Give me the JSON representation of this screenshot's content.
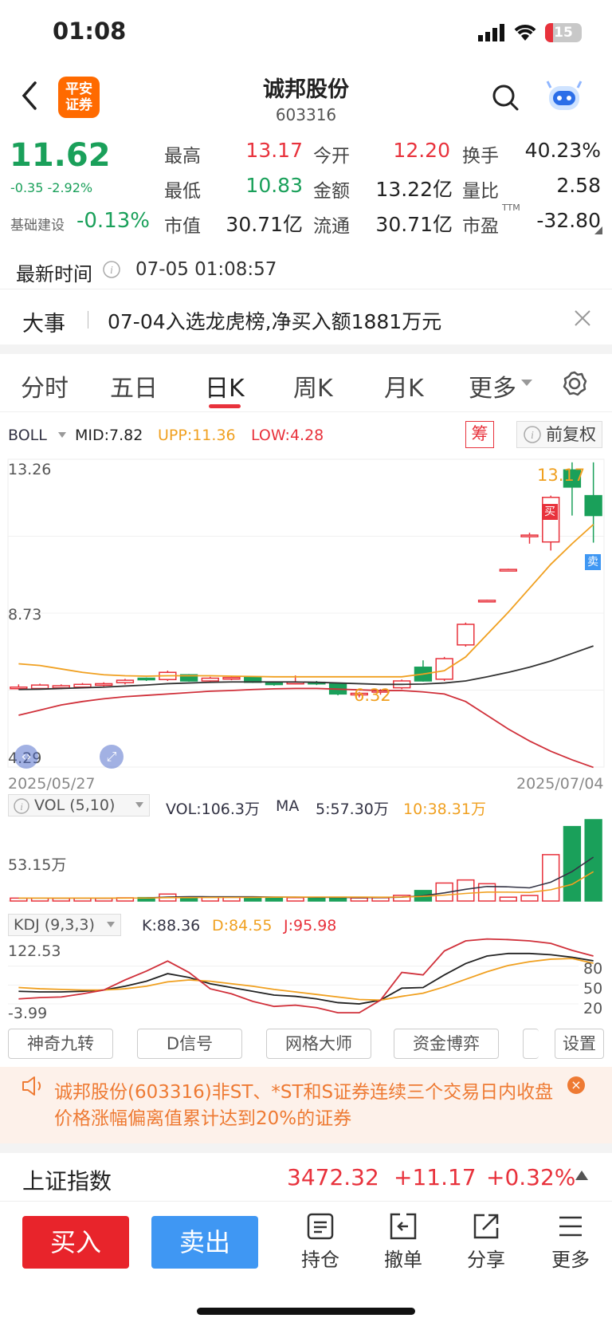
{
  "status_bar": {
    "time": "01:08",
    "battery": "15"
  },
  "header": {
    "logo_text": "平安\n证券",
    "stock_name": "诚邦股份",
    "stock_code": "603316"
  },
  "quote": {
    "price": "11.62",
    "change": "-0.35 -2.92%",
    "sector_name": "基础建设",
    "sector_change": "-0.13%",
    "fields": [
      {
        "label": "最高",
        "value": "13.17",
        "color": "red"
      },
      {
        "label": "今开",
        "value": "12.20",
        "color": "red"
      },
      {
        "label": "换手",
        "value": "40.23%",
        "color": "dark"
      },
      {
        "label": "最低",
        "value": "10.83",
        "color": "green"
      },
      {
        "label": "金额",
        "value": "13.22亿",
        "color": "dark"
      },
      {
        "label": "量比",
        "value": "2.58",
        "color": "dark"
      },
      {
        "label": "市值",
        "value": "30.71亿",
        "color": "dark"
      },
      {
        "label": "流通",
        "value": "30.71亿",
        "color": "dark"
      },
      {
        "label": "市盈",
        "value": "-32.80",
        "color": "dark"
      }
    ],
    "pe_suffix": "TTM",
    "latest_time_label": "最新时间",
    "latest_time_value": "07-05 01:08:57"
  },
  "news": {
    "title": "大事",
    "text": "07-04入选龙虎榜,净买入额1881万元"
  },
  "tabs": [
    {
      "label": "分时"
    },
    {
      "label": "五日"
    },
    {
      "label": "日K"
    },
    {
      "label": "周K"
    },
    {
      "label": "月K"
    },
    {
      "label": "更多"
    }
  ],
  "boll": {
    "name": "BOLL",
    "mid": "MID:7.82",
    "upp": "UPP:11.36",
    "low": "LOW:4.28",
    "chip_label": "筹",
    "adjust_label": "前复权",
    "y_top": "13.26",
    "y_mid": "8.73",
    "y_bottom": "4.29",
    "high_marker": "13.17",
    "low_marker": "6.32",
    "buy_tag": "买",
    "sell_tag": "卖",
    "date_start": "2025/05/27",
    "date_end": "2025/07/04"
  },
  "vol": {
    "name": "VOL (5,10)",
    "vol": "VOL:106.3万",
    "ma_label": "MA",
    "ma5": "5:57.30万",
    "ma10": "10:38.31万",
    "y_label": "53.15万"
  },
  "kdj": {
    "name": "KDJ (9,3,3)",
    "k": "K:88.36",
    "d": "D:84.55",
    "j": "J:95.98",
    "y_top": "122.53",
    "y_bottom": "-3.99",
    "levels": [
      "80",
      "50",
      "20"
    ]
  },
  "chart_buttons": [
    "神奇九转",
    "D信号",
    "网格大师",
    "资金博弈",
    "",
    "设置"
  ],
  "alert": {
    "text": "诚邦股份(603316)非ST、*ST和S证券连续三个交易日内收盘价格涨幅偏离值累计达到20%的证券"
  },
  "index": {
    "name": "上证指数",
    "value": "3472.32",
    "change": "+11.17",
    "pct": "+0.32%"
  },
  "bottom_bar": {
    "buy": "买入",
    "sell": "卖出",
    "items": [
      "持仓",
      "撤单",
      "分享",
      "更多"
    ]
  },
  "chart_data": {
    "type": "candlestick",
    "title": "",
    "categories_range": [
      "2025/05/27",
      "2025/07/04"
    ],
    "ylim": [
      4.29,
      13.26
    ],
    "candles": [
      {
        "o": 6.6,
        "c": 6.62,
        "h": 6.7,
        "l": 6.55
      },
      {
        "o": 6.58,
        "c": 6.68,
        "h": 6.72,
        "l": 6.55
      },
      {
        "o": 6.6,
        "c": 6.66,
        "h": 6.7,
        "l": 6.56
      },
      {
        "o": 6.62,
        "c": 6.7,
        "h": 6.74,
        "l": 6.58
      },
      {
        "o": 6.68,
        "c": 6.72,
        "h": 6.76,
        "l": 6.64
      },
      {
        "o": 6.75,
        "c": 6.82,
        "h": 6.86,
        "l": 6.7
      },
      {
        "o": 6.88,
        "c": 6.84,
        "h": 6.9,
        "l": 6.8
      },
      {
        "o": 6.84,
        "c": 7.05,
        "h": 7.1,
        "l": 6.8
      },
      {
        "o": 6.98,
        "c": 6.8,
        "h": 7.0,
        "l": 6.78
      },
      {
        "o": 6.8,
        "c": 6.88,
        "h": 6.92,
        "l": 6.76
      },
      {
        "o": 6.86,
        "c": 6.9,
        "h": 6.94,
        "l": 6.82
      },
      {
        "o": 6.9,
        "c": 6.76,
        "h": 6.92,
        "l": 6.74
      },
      {
        "o": 6.74,
        "c": 6.7,
        "h": 6.78,
        "l": 6.66
      },
      {
        "o": 6.72,
        "c": 6.76,
        "h": 6.96,
        "l": 6.7
      },
      {
        "o": 6.76,
        "c": 6.72,
        "h": 6.8,
        "l": 6.68
      },
      {
        "o": 6.72,
        "c": 6.42,
        "h": 6.74,
        "l": 6.38
      },
      {
        "o": 6.4,
        "c": 6.44,
        "h": 6.48,
        "l": 6.32
      },
      {
        "o": 6.48,
        "c": 6.52,
        "h": 6.56,
        "l": 6.4
      },
      {
        "o": 6.6,
        "c": 6.8,
        "h": 6.84,
        "l": 6.56
      },
      {
        "o": 7.2,
        "c": 6.8,
        "h": 7.4,
        "l": 6.78
      },
      {
        "o": 6.85,
        "c": 7.45,
        "h": 7.5,
        "l": 6.8
      },
      {
        "o": 7.85,
        "c": 8.45,
        "h": 8.5,
        "l": 7.8
      },
      {
        "o": 9.15,
        "c": 9.15,
        "h": 9.17,
        "l": 9.13
      },
      {
        "o": 10.05,
        "c": 10.05,
        "h": 10.07,
        "l": 10.03
      },
      {
        "o": 11.05,
        "c": 11.05,
        "h": 11.12,
        "l": 10.8
      },
      {
        "o": 10.85,
        "c": 12.15,
        "h": 12.2,
        "l": 10.6
      },
      {
        "o": 12.95,
        "c": 12.45,
        "h": 13.17,
        "l": 11.62
      },
      {
        "o": 12.2,
        "c": 11.62,
        "h": 13.17,
        "l": 10.83
      }
    ],
    "series": [
      {
        "name": "MID",
        "values": [
          6.55,
          6.56,
          6.58,
          6.6,
          6.62,
          6.65,
          6.68,
          6.72,
          6.74,
          6.76,
          6.77,
          6.77,
          6.77,
          6.77,
          6.76,
          6.74,
          6.72,
          6.7,
          6.7,
          6.71,
          6.74,
          6.8,
          6.92,
          7.05,
          7.2,
          7.38,
          7.6,
          7.82
        ]
      },
      {
        "name": "UPP",
        "values": [
          7.3,
          7.25,
          7.15,
          7.05,
          6.98,
          6.95,
          6.94,
          6.95,
          6.95,
          6.95,
          6.94,
          6.93,
          6.92,
          6.92,
          6.92,
          6.92,
          6.92,
          6.92,
          6.92,
          7.0,
          7.1,
          7.5,
          8.15,
          8.8,
          9.5,
          10.2,
          10.8,
          11.36
        ]
      },
      {
        "name": "LOW",
        "values": [
          5.8,
          5.95,
          6.1,
          6.2,
          6.28,
          6.34,
          6.38,
          6.42,
          6.46,
          6.5,
          6.52,
          6.55,
          6.57,
          6.58,
          6.58,
          6.56,
          6.54,
          6.52,
          6.52,
          6.48,
          6.42,
          6.2,
          5.8,
          5.4,
          5.05,
          4.75,
          4.5,
          4.28
        ]
      }
    ],
    "volume": {
      "ylim": [
        0,
        106.3
      ],
      "values": [
        3.8,
        3.9,
        3.7,
        3.8,
        3.6,
        4.2,
        4.5,
        9.1,
        5.2,
        5.0,
        4.8,
        5.1,
        4.6,
        4.4,
        4.5,
        5.0,
        4.0,
        4.3,
        7.4,
        13.7,
        23.5,
        27.5,
        22.6,
        5.0,
        7.2,
        60.6,
        97.3,
        106.3
      ],
      "ma5": [
        3.8,
        3.8,
        3.8,
        3.8,
        3.8,
        3.9,
        4.0,
        5.2,
        5.7,
        5.6,
        5.5,
        5.6,
        5.2,
        5.0,
        4.9,
        4.7,
        4.5,
        4.6,
        5.0,
        6.9,
        10.6,
        15.3,
        19.0,
        18.5,
        17.2,
        24.6,
        38.5,
        57.3
      ],
      "ma10": [
        3.8,
        3.8,
        3.8,
        3.8,
        3.8,
        3.8,
        3.9,
        4.4,
        4.5,
        4.6,
        4.7,
        4.8,
        5.0,
        5.1,
        5.2,
        5.1,
        5.1,
        5.0,
        5.2,
        6.1,
        7.7,
        9.9,
        11.7,
        11.6,
        11.3,
        14.7,
        21.8,
        38.31
      ]
    },
    "kdj": {
      "ylim": [
        -3.99,
        122.53
      ],
      "K": [
        40,
        39,
        39,
        40,
        42,
        48,
        56,
        68,
        62,
        52,
        46,
        40,
        34,
        32,
        28,
        22,
        20,
        26,
        45,
        46,
        66,
        84,
        96,
        100,
        100,
        98,
        94,
        88.36
      ],
      "D": [
        46,
        44,
        43,
        42,
        42,
        44,
        48,
        55,
        58,
        56,
        52,
        48,
        43,
        39,
        35,
        31,
        27,
        26,
        32,
        37,
        47,
        59,
        71,
        81,
        87,
        91,
        92,
        84.55
      ],
      "J": [
        28,
        30,
        31,
        36,
        42,
        58,
        72,
        88,
        70,
        44,
        36,
        24,
        16,
        18,
        14,
        6,
        6,
        26,
        70,
        66,
        104,
        120,
        123,
        122,
        120,
        116,
        105,
        95.98
      ]
    }
  }
}
